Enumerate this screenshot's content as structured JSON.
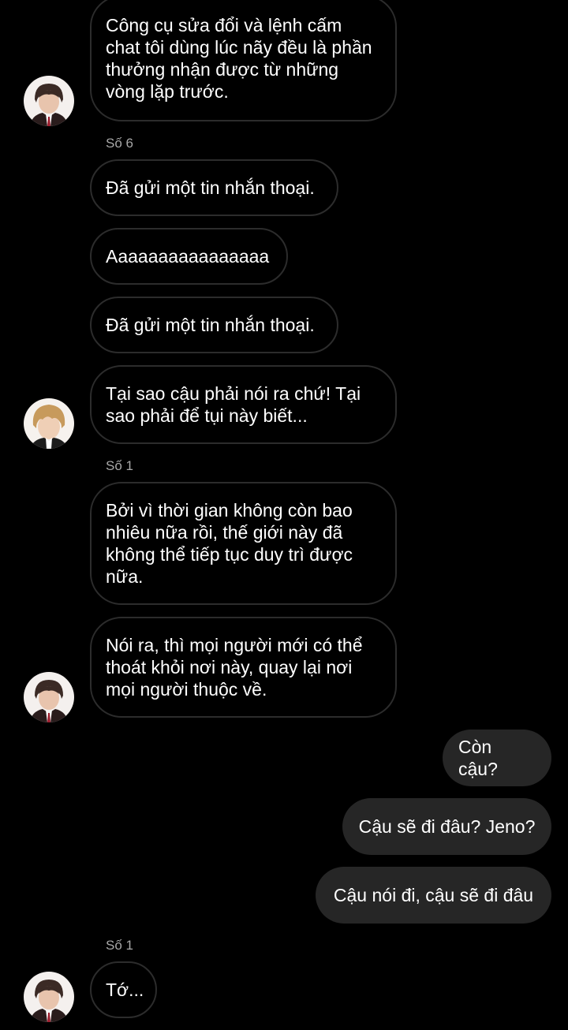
{
  "messages": {
    "m1": "Công cụ sửa đổi và lệnh cấm chat tôi dùng lúc nãy đều là phần thưởng nhận được từ những vòng lặp trước.",
    "sender_so6": "Số 6",
    "m2": "Đã gửi một tin nhắn thoại.",
    "m3": "Aaaaaaaaaaaaaaaa",
    "m4": "Đã gửi một tin nhắn thoại.",
    "m5": "Tại sao cậu phải nói ra chứ! Tại sao phải để tụi này biết...",
    "sender_so1_a": "Số 1",
    "m6": "Bởi vì thời gian không còn bao nhiêu nữa rồi, thế giới này đã không thể tiếp tục duy trì được nữa.",
    "m7": "Nói ra, thì mọi người mới có thể thoát khỏi nơi này, quay lại nơi mọi người thuộc về.",
    "out1": "Còn cậu?",
    "out2": "Cậu sẽ đi đâu? Jeno?",
    "out3": "Cậu nói đi, cậu sẽ đi đâu",
    "sender_so1_b": "Số 1",
    "m8": "Tớ..."
  },
  "colors": {
    "background": "#000000",
    "incoming_border": "#2c2c2c",
    "outgoing_bg": "#262626",
    "sender_label": "#a8a8a8"
  },
  "icons": {
    "avatar_a": "avatar-boy-dark-hair-red-tie",
    "avatar_b": "avatar-boy-light-hair"
  }
}
